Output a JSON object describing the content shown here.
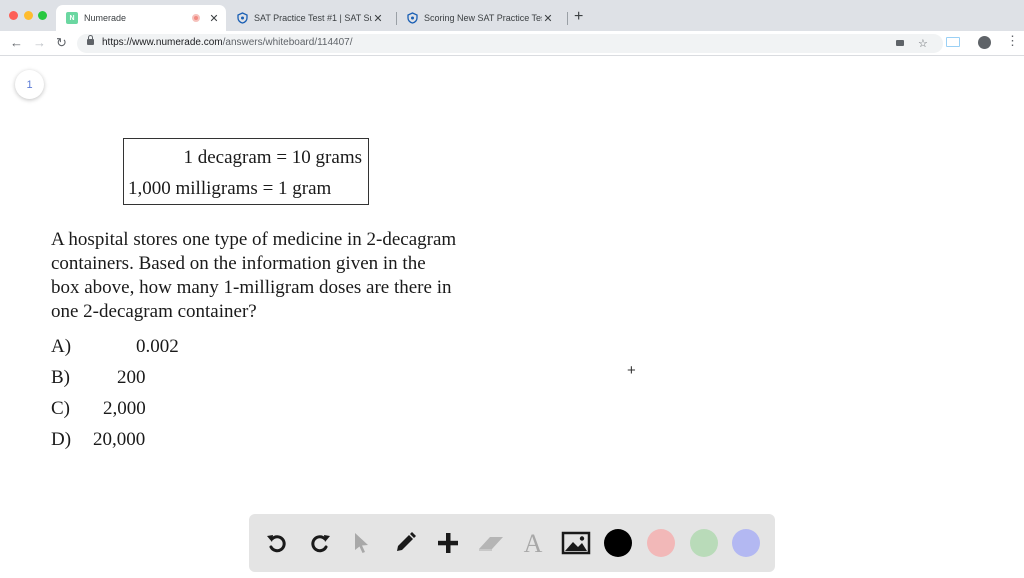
{
  "browser": {
    "tabs": [
      {
        "title": "Numerade",
        "favicon": "N"
      },
      {
        "title": "SAT Practice Test #1 | SAT Sui"
      },
      {
        "title": "Scoring New SAT Practice Tes"
      }
    ],
    "url_host": "https://www.numerade.com",
    "url_path": "/answers/whiteboard/114407/"
  },
  "whiteboard": {
    "page_number": "1",
    "conversions": [
      "1 decagram = 10 grams",
      "1,000 milligrams = 1 gram"
    ],
    "question_lines": [
      "A hospital stores one type of medicine in 2-decagram",
      "containers.  Based on the information given in the",
      "box above, how many 1-milligram doses are there in",
      "one 2-decagram container?"
    ],
    "choices": [
      {
        "letter": "A)",
        "value": "0.002"
      },
      {
        "letter": "B)",
        "value": "200"
      },
      {
        "letter": "C)",
        "value": "2,000"
      },
      {
        "letter": "D)",
        "value": "20,000"
      }
    ]
  },
  "toolbar": {
    "tools": [
      "undo-icon",
      "redo-icon",
      "pointer-icon",
      "pen-icon",
      "plus-icon",
      "eraser-icon",
      "text-icon",
      "image-icon"
    ],
    "colors": [
      "#000000",
      "#f2b8b8",
      "#b9dbb9",
      "#b3b8f2"
    ]
  }
}
